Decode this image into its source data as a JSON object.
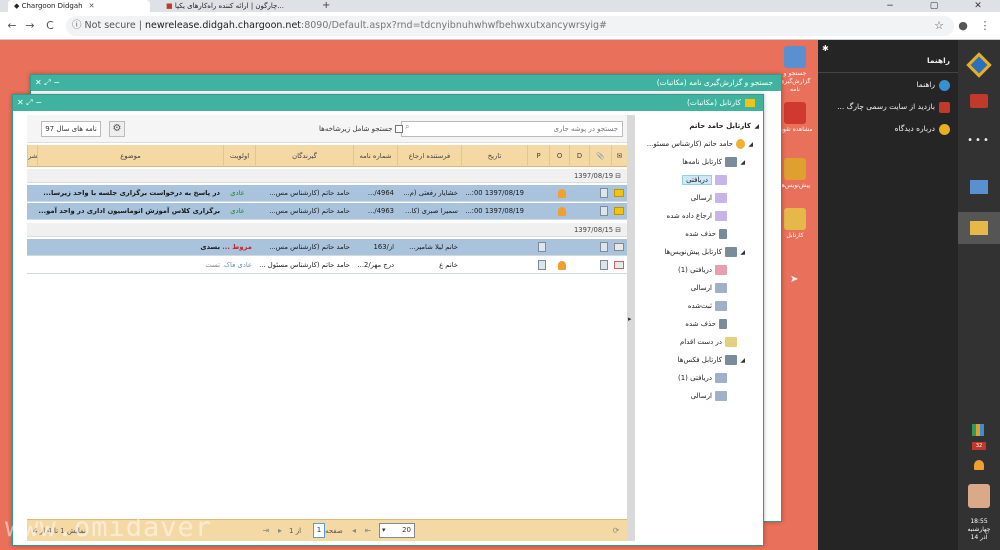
{
  "browser": {
    "tabs": [
      {
        "title": "Chargoon Didgah",
        "active": true
      },
      {
        "title": "چارگون | ارائه کننده راه‌کارهای یکپا...",
        "active": false
      }
    ],
    "new_tab": "+",
    "window_controls": [
      "−",
      "▢",
      "✕"
    ],
    "nav": {
      "back": "←",
      "forward": "→",
      "reload": "C"
    },
    "security": "Not secure",
    "url_host": "newrelease.didgah.chargoon.net",
    "url_rest": ":8090/Default.aspx?rnd=tdcnyibnuhwhwfbehwxutxancywrsyig#",
    "star": "☆"
  },
  "rightbar": {
    "icons": [
      "didgah-logo-icon",
      "briefcase-icon",
      "more-icon",
      "letter-search-icon",
      "inbox-icon"
    ],
    "more_label": "•••",
    "notif_count": "32",
    "clock_time": "18:55",
    "clock_day": "چهارشنبه",
    "clock_date": "14 آذر"
  },
  "helppanel": {
    "title": "راهنما",
    "items": [
      "راهنما",
      "بازدید از سایت رسمی چارگ ...",
      "درباره دیدگاه"
    ]
  },
  "desktop_icons": [
    {
      "label": "جستجو و گزارش‌گیری نامه",
      "icon_color": "#5a8fd0"
    },
    {
      "label": "مشاهده تقویم",
      "icon_color": "#d0392f"
    },
    {
      "label": "پیش‌نویس‌ها",
      "icon_color": "#e0a030"
    },
    {
      "label": "کارتابل",
      "icon_color": "#e6b84a"
    }
  ],
  "win_back": {
    "title": "جستجو و گزارش‌گیری نامه (مکاتبات)"
  },
  "win_front": {
    "title": "کارتابل (مکاتبات)",
    "search_placeholder": "جستجو در پوشه جاری",
    "search_sub_label": "جستجو شامل زیرشاخه‌ها",
    "year_button": "نامه های سال 97",
    "columns": {
      "envelope": "✉",
      "attach": "📎",
      "D": "D",
      "O": "O",
      "P": "P",
      "date": "تاریخ",
      "sender": "فرستنده ارجاع",
      "letter_no": "شماره نامه",
      "recipient": "گیرندگان",
      "priority": "اولویت",
      "subject": "موضوع",
      "more": "شر"
    },
    "groups": [
      {
        "label": "1397/08/19",
        "rows": [
          {
            "date": "1397/08/19 00:...",
            "sender": "خشایار رفعتی (م...",
            "letter_no": "4964/...",
            "recipient": "حامد حاتم (کارشناس مس...",
            "priority": "عادی",
            "subject": "در پاسخ به درخواست برگزاری جلسه با واحد زیرسا..."
          },
          {
            "date": "1397/08/19 00:...",
            "sender": "سمیرا صبری (کا...",
            "letter_no": "4963/...",
            "recipient": "حامد حاتم (کارشناس مس...",
            "priority": "عادی",
            "subject": "برگزاری کلاس آموزش اتوماسیون اداری در واحد آمو..."
          }
        ]
      },
      {
        "label": "1397/08/15",
        "rows": [
          {
            "date": "",
            "sender": "خانم لیلا شامیر...",
            "letter_no": "از/163",
            "recipient": "حامد حاتم (کارشناس مس...",
            "priority": "مروط ...",
            "subject": "بسدی"
          },
          {
            "date": "",
            "sender": "خانم ع",
            "letter_no": "درج مهر/2...",
            "recipient": "حامد حاتم (کارشناس مسئول ...",
            "priority": "عادی فاک...",
            "subject": "تست"
          }
        ]
      }
    ],
    "pager": {
      "page_size": "20",
      "page_label": "صفحه",
      "page_value": "1",
      "of_label": "از 1",
      "summary": "نمایش 1 تا 4 از 4"
    },
    "tree": [
      {
        "label": "کارتابل حامد حاتم",
        "level": 0,
        "icon": "#d0392f"
      },
      {
        "label": "حامد حاتم (کارشناس مسئو...",
        "level": 1,
        "icon": "#f0b030"
      },
      {
        "label": "کارتابل نامه‌ها",
        "level": 2,
        "icon": "#7a8b9a"
      },
      {
        "label": "دریافتی",
        "level": 3,
        "icon": "#c7b4e8",
        "selected": true
      },
      {
        "label": "ارسالی",
        "level": 3,
        "icon": "#c7b4e8"
      },
      {
        "label": "ارجاع داده شده",
        "level": 3,
        "icon": "#c7b4e8"
      },
      {
        "label": "حذف شده",
        "level": 3,
        "icon": "#7a8b9a"
      },
      {
        "label": "کارتابل پیش‌نویس‌ها",
        "level": 2,
        "icon": "#7a8b9a"
      },
      {
        "label": "دریافتی (1)",
        "level": 3,
        "icon": "#e6a0b0"
      },
      {
        "label": "ارسالی",
        "level": 3,
        "icon": "#a0b0c8"
      },
      {
        "label": "ثبت‌شده",
        "level": 3,
        "icon": "#a0b0c8"
      },
      {
        "label": "حذف شده",
        "level": 3,
        "icon": "#7a8b9a"
      },
      {
        "label": "در دست اقدام",
        "level": 2,
        "icon": "#e6d080"
      },
      {
        "label": "کارتابل فکس‌ها",
        "level": 2,
        "icon": "#7a8b9a"
      },
      {
        "label": "دریافتی (1)",
        "level": 3,
        "icon": "#a0b0c8"
      },
      {
        "label": "ارسالی",
        "level": 3,
        "icon": "#a0b0c8"
      }
    ]
  },
  "watermark": "www.omidaver"
}
